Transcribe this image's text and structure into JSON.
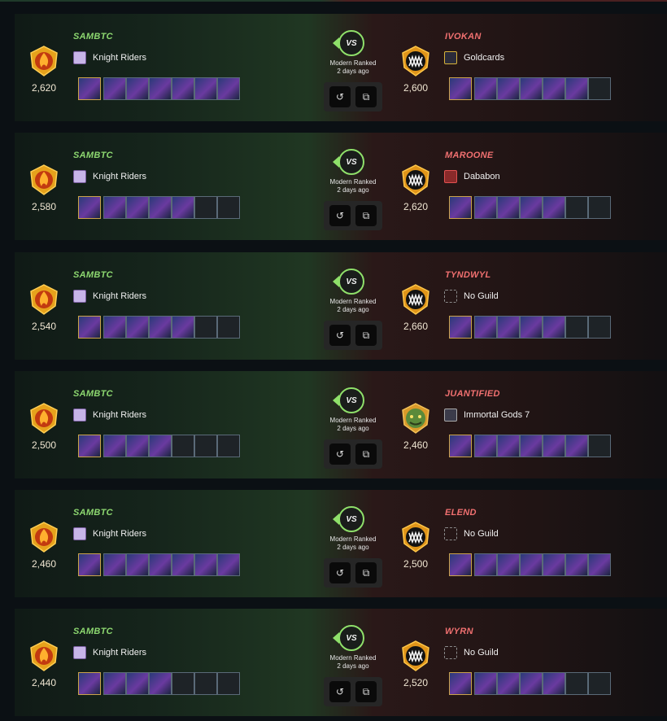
{
  "battles": [
    {
      "left": {
        "name": "SAMBTC",
        "guild": "Knight Riders",
        "guild_icon": "knight",
        "rating": "2,620",
        "emblem": "fire",
        "cards_filled": 7
      },
      "right": {
        "name": "IVOKAN",
        "guild": "Goldcards",
        "guild_icon": "gold",
        "rating": "2,600",
        "emblem": "monster",
        "cards_filled": 6
      },
      "mode": "Modern Ranked",
      "time": "2 days ago",
      "vs": "VS"
    },
    {
      "left": {
        "name": "SAMBTC",
        "guild": "Knight Riders",
        "guild_icon": "knight",
        "rating": "2,580",
        "emblem": "fire",
        "cards_filled": 5
      },
      "right": {
        "name": "MAROONE",
        "guild": "Dababon",
        "guild_icon": "red",
        "rating": "2,620",
        "emblem": "monster",
        "cards_filled": 5
      },
      "mode": "Modern Ranked",
      "time": "2 days ago",
      "vs": "VS"
    },
    {
      "left": {
        "name": "SAMBTC",
        "guild": "Knight Riders",
        "guild_icon": "knight",
        "rating": "2,540",
        "emblem": "fire",
        "cards_filled": 5
      },
      "right": {
        "name": "TYNDWYL",
        "guild": "No Guild",
        "guild_icon": "none",
        "rating": "2,660",
        "emblem": "monster",
        "cards_filled": 5
      },
      "mode": "Modern Ranked",
      "time": "2 days ago",
      "vs": "VS"
    },
    {
      "left": {
        "name": "SAMBTC",
        "guild": "Knight Riders",
        "guild_icon": "knight",
        "rating": "2,500",
        "emblem": "fire",
        "cards_filled": 4
      },
      "right": {
        "name": "JUANTIFIED",
        "guild": "Immortal Gods 7",
        "guild_icon": "gods",
        "rating": "2,460",
        "emblem": "goblin",
        "cards_filled": 6
      },
      "mode": "Modern Ranked",
      "time": "2 days ago",
      "vs": "VS"
    },
    {
      "left": {
        "name": "SAMBTC",
        "guild": "Knight Riders",
        "guild_icon": "knight",
        "rating": "2,460",
        "emblem": "fire",
        "cards_filled": 7
      },
      "right": {
        "name": "ELEND",
        "guild": "No Guild",
        "guild_icon": "none",
        "rating": "2,500",
        "emblem": "monster",
        "cards_filled": 7
      },
      "mode": "Modern Ranked",
      "time": "2 days ago",
      "vs": "VS"
    },
    {
      "left": {
        "name": "SAMBTC",
        "guild": "Knight Riders",
        "guild_icon": "knight",
        "rating": "2,440",
        "emblem": "fire",
        "cards_filled": 4
      },
      "right": {
        "name": "WYRN",
        "guild": "No Guild",
        "guild_icon": "none",
        "rating": "2,520",
        "emblem": "monster",
        "cards_filled": 5
      },
      "mode": "Modern Ranked",
      "time": "2 days ago",
      "vs": "VS"
    }
  ],
  "icons": {
    "rematch": "replay-icon",
    "copy": "copy-icon"
  },
  "colors": {
    "winner_name": "#8dd870",
    "loser_name": "#f07070",
    "vs_ring": "#8fe06a"
  }
}
